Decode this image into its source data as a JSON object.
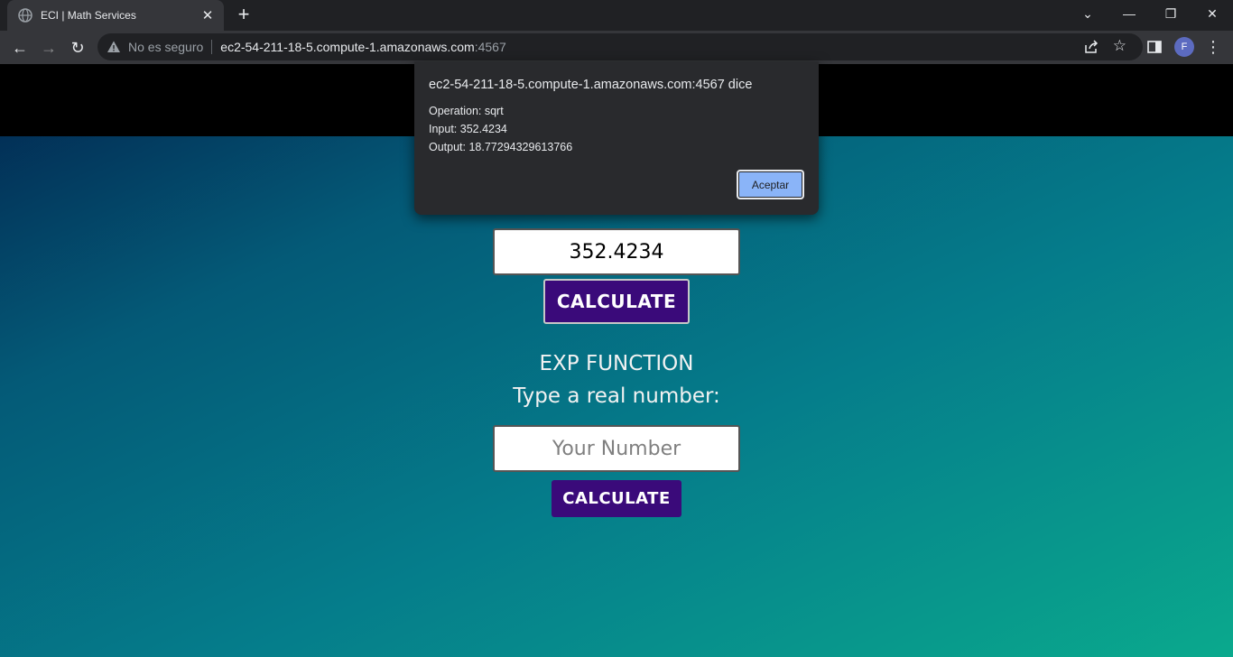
{
  "browser": {
    "tab_title": "ECI | Math Services",
    "tab_close": "✕",
    "new_tab": "+",
    "tab_search": "⌄",
    "minimize": "—",
    "restore": "❐",
    "close": "✕",
    "back": "←",
    "forward": "→",
    "reload": "↻",
    "security_label": "No es seguro",
    "url_host": "ec2-54-211-18-5.compute-1.amazonaws.com",
    "url_port": ":4567",
    "bookmark": "☆",
    "profile_initial": "F",
    "menu": "⋮"
  },
  "page": {
    "sqrt_input_value": "352.4234",
    "calc_button_1": "CALCULATE",
    "exp_title": "EXP FUNCTION",
    "exp_prompt": "Type a real number:",
    "exp_input_placeholder": "Your Number",
    "calc_button_2": "CALCULATE"
  },
  "dialog": {
    "title": "ec2-54-211-18-5.compute-1.amazonaws.com:4567 dice",
    "operation": "Operation: sqrt",
    "input": "Input: 352.4234",
    "output": "Output: 18.77294329613766",
    "ok_label": "Aceptar"
  },
  "colors": {
    "button_bg": "#3a0a7a",
    "dialog_button": "#8ab4f8",
    "gradient_start": "#02244e",
    "gradient_end": "#0aa98d"
  }
}
